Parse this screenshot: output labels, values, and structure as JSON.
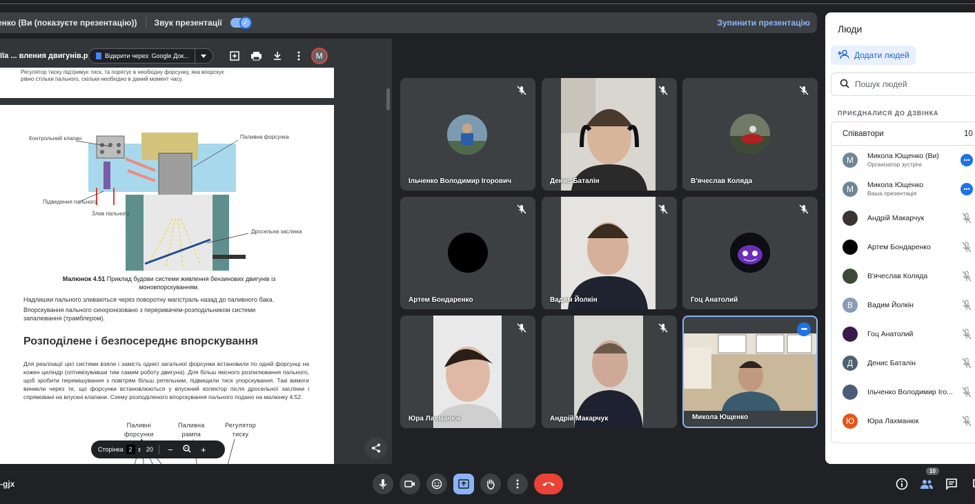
{
  "banner": {
    "presenter": "енко (Ви (показуєте презентацію))",
    "sound_label": "Звук презентації",
    "stop_label": "Зупинити презентацію"
  },
  "pdf": {
    "title": "її́а ... вления двигунів.pdf",
    "open_with": "Відкрити через: Google Док...",
    "avatar_letter": "M",
    "page1_lines": [
      "Регулятор тиску підтримує тиск, та порятує в необхідну форсунку, яка впорскує",
      "рівно стільки пального, скільки необхідно в даний момент часу."
    ],
    "fig_labels": {
      "control_valve": "Контрольний клапан",
      "injector": "Паливна форсунка",
      "supply": "Підведення пального",
      "drain": "Злив пального",
      "throttle": "Дросельна заслінка"
    },
    "caption_bold": "Малюнок 4.51",
    "caption_text": " Приклад будови системи живлення бензинових двигунів із моновпорскуванням.",
    "text1": "Надлишки пального зливаються через поворотну магістраль назад до паливного бака.",
    "text2": "Впорскування пального синхронізовано з переривачем-розподільником системи запалювання (трамблером).",
    "heading": "Розподілене і безпосереднє впорскування",
    "paragraph": "Для реалізації цієї системи взяли і замість однієї загальної форсунки встановили по одній форсунці на кожен циліндр (оптимізувавши тим самим роботу двигуна). Для більш якісного розпилювання пального, щоб зробити перемішування з повітрям більш ретельним, підвищили тиск упорскування. Такі вимоги виникли через те, що форсунки встановлюються у впускний колектор після дросельної заслінки і спрямовані на впускні клапани. Схему розподіленого впорскування пального подано на малюнку 4.52.",
    "fig2": {
      "injectors_1": "Паливні",
      "injectors_2": "форсунки",
      "rail_1": "Паливна",
      "rail_2": "рампа",
      "regulator_1": "Регулятор",
      "regulator_2": "тиску"
    },
    "pagenav": {
      "label": "Сторінка",
      "current": "2",
      "of": "з",
      "total": "20"
    }
  },
  "tiles": [
    {
      "name": "Ільченко Володимир Ігорович"
    },
    {
      "name": "Денис Баталін"
    },
    {
      "name": "В'ячеслав Коляда"
    },
    {
      "name": "Артем Бондаренко"
    },
    {
      "name": "Вадим Йолкін"
    },
    {
      "name": "Гоц Анатолий"
    },
    {
      "name": "Юра Лахманюк"
    },
    {
      "name": "Андрій Макарчук"
    },
    {
      "name": "Микола Ющенко"
    }
  ],
  "people": {
    "title": "Люди",
    "add_label": "Додати людей",
    "search_placeholder": "Пошук людей",
    "joined_label": "ПРИЄДНАЛИСЯ ДО ДЗВІНКА",
    "group_label": "Співавтори",
    "group_count": "10",
    "list": [
      {
        "name": "Микола Ющенко (Ви)",
        "sub": "Організатор зустрічі",
        "initial": "М",
        "color": "#6f8696"
      },
      {
        "name": "Микола Ющенко",
        "sub": "Ваша презентація",
        "initial": "М",
        "color": "#6f8696"
      },
      {
        "name": "Андрій Макарчук",
        "sub": "",
        "initial": "",
        "color": "#3b3431"
      },
      {
        "name": "Артем Бондаренко",
        "sub": "",
        "initial": "",
        "color": "#000000"
      },
      {
        "name": "В'ячеслав Коляда",
        "sub": "",
        "initial": "",
        "color": "#3d4a3a"
      },
      {
        "name": "Вадим Йолкін",
        "sub": "",
        "initial": "В",
        "color": "#8a9bb5"
      },
      {
        "name": "Гоц Анатолий",
        "sub": "",
        "initial": "",
        "color": "#3a1a4a"
      },
      {
        "name": "Денис Баталін",
        "sub": "",
        "initial": "Д",
        "color": "#4e6170"
      },
      {
        "name": "Ільченко Володимир Іго...",
        "sub": "",
        "initial": "",
        "color": "#4b5c7a"
      },
      {
        "name": "Юра Лахманюк",
        "sub": "",
        "initial": "Ю",
        "color": "#e8541c"
      }
    ]
  },
  "bottom": {
    "meeting_code": "-gjx",
    "people_count": "10"
  }
}
